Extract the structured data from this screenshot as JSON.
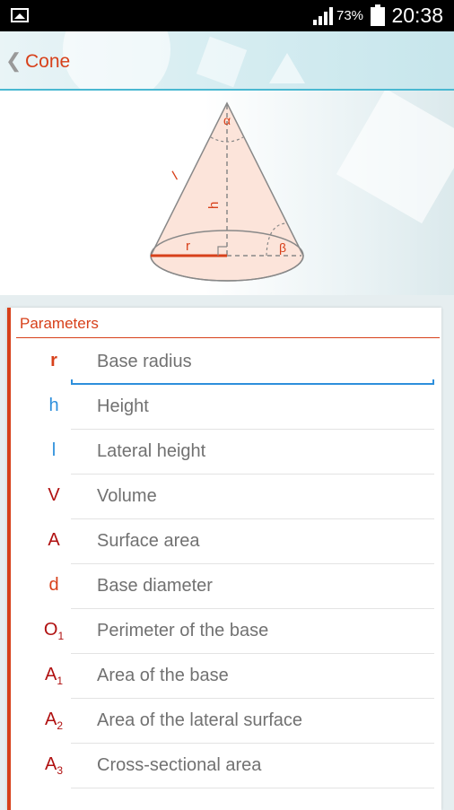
{
  "status": {
    "battery": "73%",
    "time": "20:38"
  },
  "appbar": {
    "title": "Cone"
  },
  "diagram": {
    "labels": {
      "alpha": "α",
      "l": "l",
      "h": "h",
      "r": "r",
      "beta": "β"
    }
  },
  "colors": {
    "accent": "#d7401a",
    "blue": "#2d8fdc",
    "dark_red": "#b01010"
  },
  "parameters": {
    "title": "Parameters",
    "items": [
      {
        "symbol": "r",
        "sub": "",
        "label": "Base radius",
        "color": "#d7401a",
        "bold": true
      },
      {
        "symbol": "h",
        "sub": "",
        "label": "Height",
        "color": "#2d8fdc"
      },
      {
        "symbol": "l",
        "sub": "",
        "label": "Lateral height",
        "color": "#2d8fdc"
      },
      {
        "symbol": "V",
        "sub": "",
        "label": "Volume",
        "color": "#b01010"
      },
      {
        "symbol": "A",
        "sub": "",
        "label": "Surface area",
        "color": "#b01010"
      },
      {
        "symbol": "d",
        "sub": "",
        "label": "Base diameter",
        "color": "#d7401a"
      },
      {
        "symbol": "O",
        "sub": "1",
        "label": "Perimeter of the base",
        "color": "#b01010"
      },
      {
        "symbol": "A",
        "sub": "1",
        "label": "Area of the base",
        "color": "#b01010"
      },
      {
        "symbol": "A",
        "sub": "2",
        "label": "Area of the lateral surface",
        "color": "#b01010"
      },
      {
        "symbol": "A",
        "sub": "3",
        "label": "Cross-sectional area",
        "color": "#b01010"
      }
    ]
  }
}
